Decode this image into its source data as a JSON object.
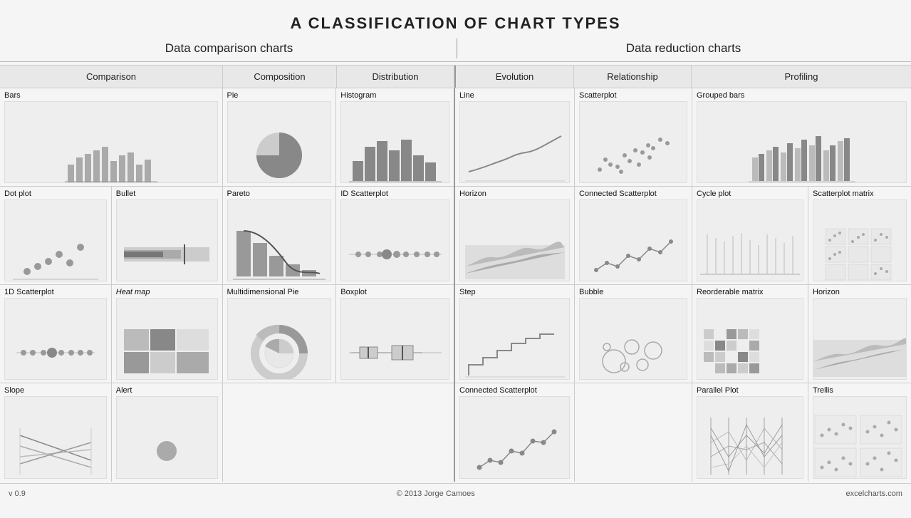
{
  "title": "A CLASSIFICATION OF CHART TYPES",
  "sections": {
    "left_label": "Data comparison charts",
    "right_label": "Data reduction charts"
  },
  "categories": [
    "Comparison",
    "Composition",
    "Distribution",
    "Evolution",
    "Relationship",
    "Profiling"
  ],
  "footer": {
    "version": "v 0.9",
    "author": "© 2013 Jorge Camoes",
    "site": "excelcharts.com"
  },
  "charts": {
    "comparison": [
      "Bars",
      "Dot plot",
      "Bullet",
      "1D Scatterplot",
      "Heat map",
      "Slope",
      "Alert"
    ],
    "composition": [
      "Pie",
      "Pareto",
      "Multidimensional Pie"
    ],
    "distribution": [
      "Histogram",
      "ID Scatterplot",
      "Boxplot"
    ],
    "evolution": [
      "Line",
      "Horizon",
      "Step",
      "Connected Scatterplot"
    ],
    "relationship": [
      "Scatterplot",
      "Connected Scatterplot",
      "Bubble"
    ],
    "profiling": [
      "Grouped bars",
      "Cycle plot",
      "Scatterplot matrix",
      "Reorderable matrix",
      "Horizon",
      "Parallel Plot",
      "Trellis"
    ]
  }
}
